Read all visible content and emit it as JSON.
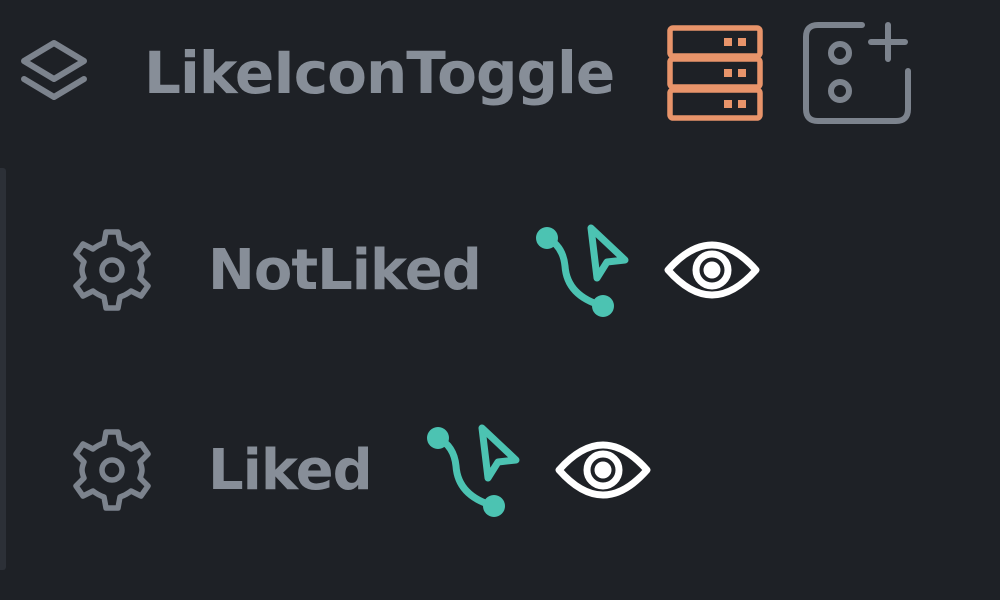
{
  "colors": {
    "background": "#1e2126",
    "label": "#878e98",
    "icon_muted": "#7c838d",
    "accent_orange": "#e8946a",
    "accent_teal": "#4cc3b2",
    "eye": "#ffffff"
  },
  "header": {
    "title": "LikeIconToggle",
    "layers_icon": "layers-icon",
    "database_icon": "database-icon",
    "add_icon": "add-component-icon"
  },
  "states": [
    {
      "label": "NotLiked",
      "settings_icon": "gear-icon",
      "interaction_icon": "interaction-flow-icon",
      "visibility_icon": "eye-icon"
    },
    {
      "label": "Liked",
      "settings_icon": "gear-icon",
      "interaction_icon": "interaction-flow-icon",
      "visibility_icon": "eye-icon"
    }
  ]
}
